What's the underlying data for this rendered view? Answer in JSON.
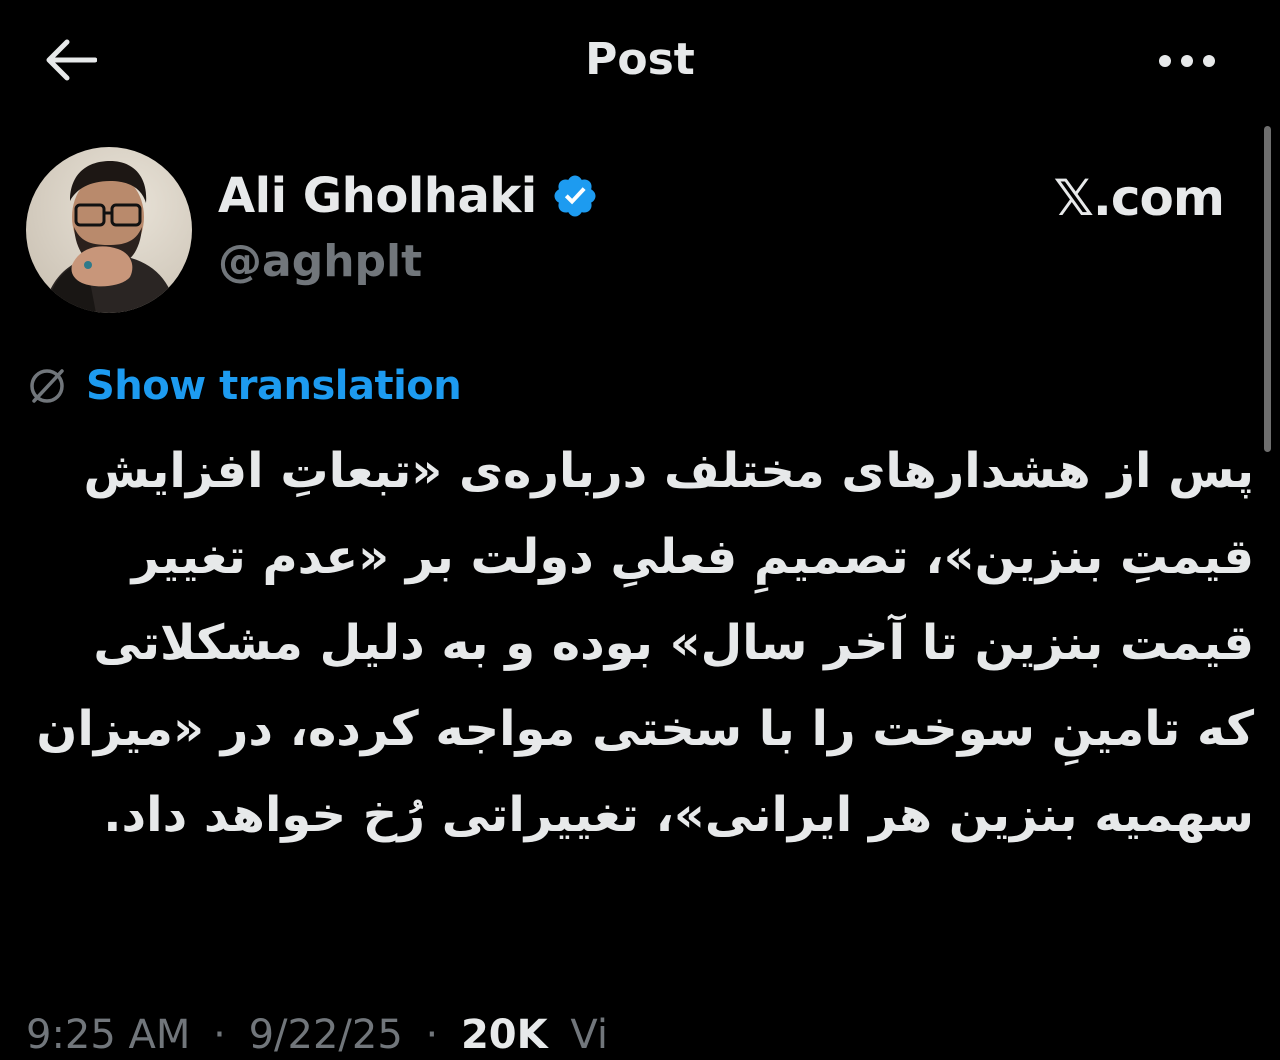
{
  "header": {
    "title": "Post",
    "back_icon": "arrow-left-icon",
    "more_icon": "more-horizontal-icon"
  },
  "author": {
    "display_name": "Ali Gholhaki",
    "handle": "@aghplt",
    "verified": true,
    "verified_color": "#1d9bf0",
    "avatar_icon": "user-avatar-photo"
  },
  "source_label": "𝕏.com",
  "translation": {
    "label": "Show translation",
    "icon": "translate-globe-icon",
    "link_color": "#1d9bf0"
  },
  "post": {
    "text": "پس از هشدارهای مختلف درباره‌ی «تبعاتِ افزایش قیمتِ بنزین»، تصمیمِ فعلیِ دولت بر «عدم تغییر قیمت بنزین تا آخر سال» بوده و به دلیل مشکلاتی که تامینِ سوخت را با سختی مواجه کرده، در «میزان سهمیه بنزین هر ایرانی»، تغییراتی رُخ خواهد داد."
  },
  "meta": {
    "time": "9:25 AM",
    "separator": "·",
    "date": "9/22/25",
    "views_count": "20K",
    "views_label": "Vi"
  },
  "colors": {
    "background": "#000000",
    "text_primary": "#e7e9ea",
    "text_secondary": "#71767b",
    "accent": "#1d9bf0"
  }
}
